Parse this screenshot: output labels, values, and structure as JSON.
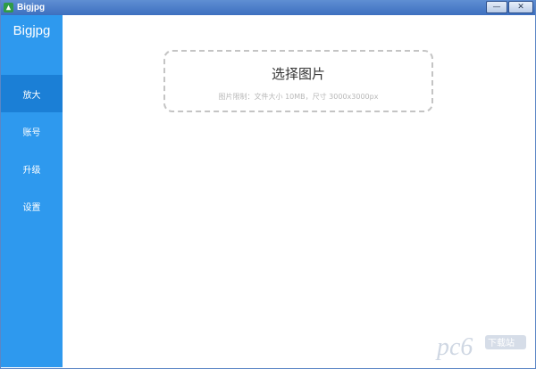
{
  "window": {
    "title": "Bigjpg",
    "minimize_glyph": "—",
    "close_glyph": "✕",
    "icon": "leaf-app-icon"
  },
  "sidebar": {
    "brand": "Bigjpg",
    "items": [
      {
        "label": "放大",
        "active": true
      },
      {
        "label": "账号",
        "active": false
      },
      {
        "label": "升级",
        "active": false
      },
      {
        "label": "设置",
        "active": false
      }
    ]
  },
  "main": {
    "dropzone": {
      "title": "选择图片",
      "hint": "图片限制：文件大小 10MB，尺寸 3000x3000px"
    }
  },
  "watermark": {
    "text": "pc6 下载站"
  },
  "colors": {
    "sidebar": "#2e99ee",
    "sidebar_active": "#1b7fd6",
    "titlebar": "#4d7fca",
    "dropzone_border": "#c4c4c4"
  }
}
